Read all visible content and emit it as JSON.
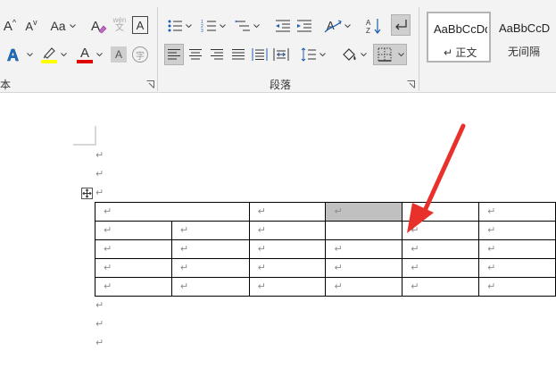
{
  "ribbon": {
    "font_group_caption": "本",
    "paragraph_group_caption": "段落",
    "font": {
      "grow_label": "A",
      "shrink_label": "A",
      "change_case_label": "Aa",
      "phonetic_top": "wén",
      "phonetic_bottom": "文",
      "char_border_label": "A",
      "text_effect_label": "A",
      "font_color_label": "A",
      "char_shading_label": "A",
      "enclose_char_label": "字",
      "highlight_color": "#ffff00",
      "font_color": "#e00000"
    },
    "styles": [
      {
        "sample": "AaBbCcDd",
        "name": "↵ 正文",
        "selected": true
      },
      {
        "sample": "AaBbCcD",
        "name": "无间隔",
        "selected": false
      }
    ]
  },
  "document": {
    "paragraph_mark": "↵",
    "table": {
      "rows": [
        [
          "↵",
          "↵",
          "↵",
          "↵",
          "↵"
        ],
        [
          "↵",
          "↵",
          "↵",
          "",
          "↵",
          "↵"
        ],
        [
          "↵",
          "↵",
          "↵",
          "↵",
          "↵",
          "↵"
        ],
        [
          "↵",
          "↵",
          "↵",
          "↵",
          "↵",
          "↵"
        ],
        [
          "↵",
          "↵",
          "↵",
          "↵",
          "↵",
          "↵"
        ]
      ]
    },
    "arrow_color": "#e8312b"
  }
}
